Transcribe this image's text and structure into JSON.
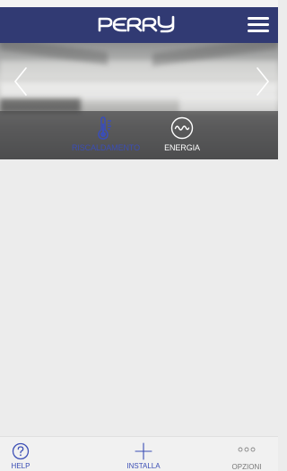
{
  "header": {
    "logo_text": "PERRY",
    "menu_icon": "hamburger-menu-icon"
  },
  "hero": {
    "prev_icon": "chevron-left-icon",
    "next_icon": "chevron-right-icon"
  },
  "modes": [
    {
      "label": "RISCALDAMENTO",
      "icon": "thermometer-icon",
      "color": "#3b4eb5"
    },
    {
      "label": "ENERGIA",
      "icon": "energy-wave-icon",
      "color": "#ffffff"
    }
  ],
  "tabbar": {
    "help_label": "HELP",
    "install_label": "INSTALLA",
    "options_label": "OPZIONI"
  },
  "colors": {
    "header_bg": "#313a73",
    "accent": "#3b4eb5",
    "page_bg": "#ececec"
  }
}
